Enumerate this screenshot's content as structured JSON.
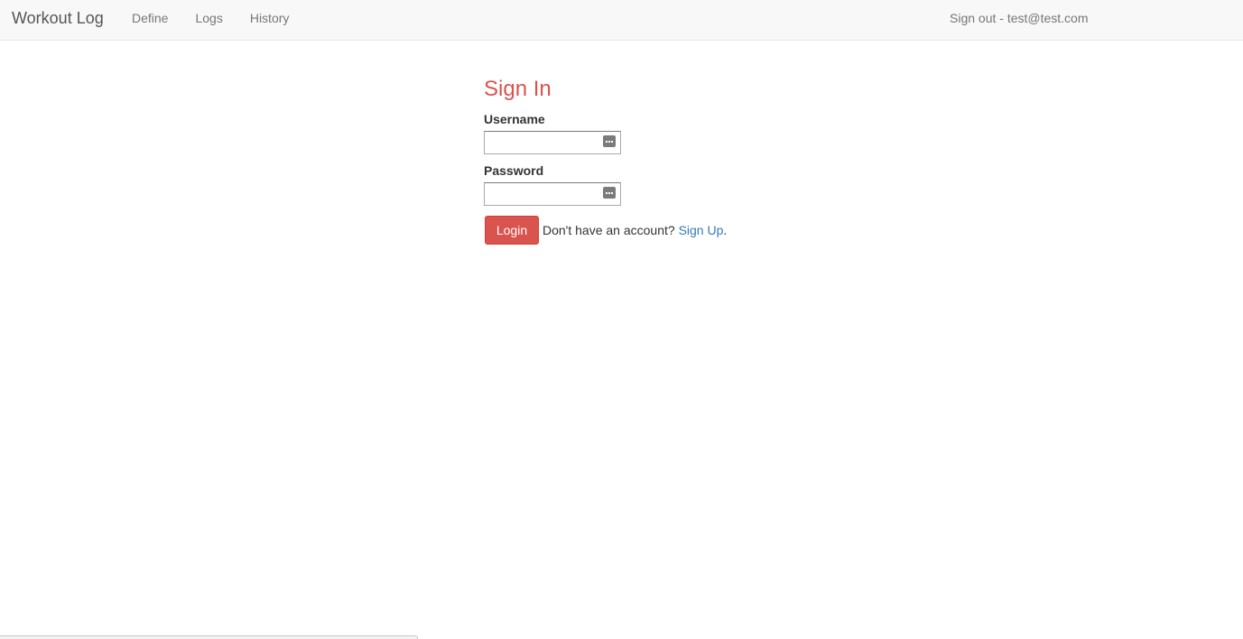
{
  "navbar": {
    "brand": "Workout Log",
    "links": [
      {
        "label": "Define"
      },
      {
        "label": "Logs"
      },
      {
        "label": "History"
      }
    ],
    "signout": "Sign out - test@test.com"
  },
  "signin": {
    "title": "Sign In",
    "username_label": "Username",
    "username_value": "",
    "password_label": "Password",
    "password_value": "",
    "login_button": "Login",
    "prompt": "Don't have an account?",
    "signup_link": "Sign Up",
    "signup_suffix": "."
  },
  "colors": {
    "accent": "#d9534f",
    "link": "#337ab7",
    "navbar_bg": "#f8f8f8"
  },
  "icons": {
    "field_icon": "password-manager-key-icon"
  }
}
